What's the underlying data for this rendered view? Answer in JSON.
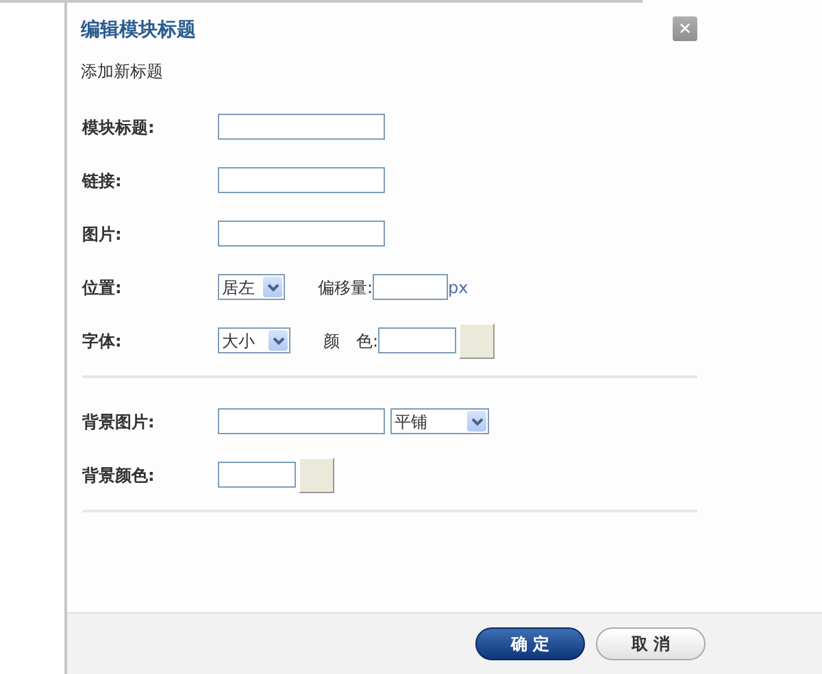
{
  "dialog": {
    "title": "编辑模块标题",
    "subtitle": "添加新标题",
    "close": "✕"
  },
  "sections": [
    {
      "rows": [
        {
          "kind": "text",
          "label": "模块标题:"
        },
        {
          "kind": "text",
          "label": "链接:"
        },
        {
          "kind": "text",
          "label": "图片:"
        },
        {
          "kind": "select-offset",
          "label": "位置:",
          "select": "居左",
          "extra_label": "偏移量:",
          "unit": "px"
        },
        {
          "kind": "select-color",
          "label": "字体:",
          "select": "大小",
          "extra_label": "颜　色:"
        }
      ]
    },
    {
      "rows": [
        {
          "kind": "text-select",
          "label": "背景图片:",
          "select": "平铺"
        },
        {
          "kind": "color",
          "label": "背景颜色:"
        }
      ]
    }
  ],
  "buttons": [
    {
      "label": "确 定",
      "kind": "primary"
    },
    {
      "label": "取 消",
      "kind": "secondary"
    }
  ]
}
